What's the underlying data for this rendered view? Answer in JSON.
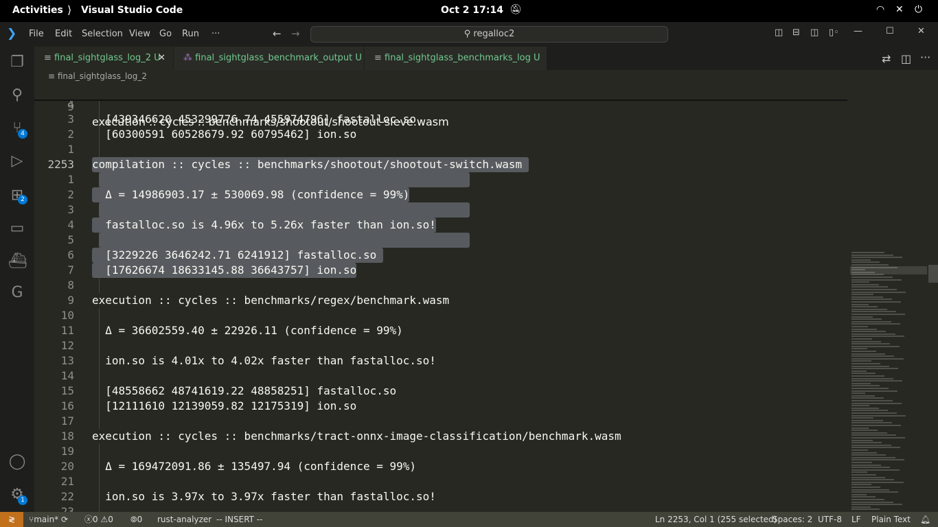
{
  "system_bar": {
    "activities": "Activities",
    "app": "Visual Studio Code",
    "clock": "Oct 2  17:14"
  },
  "menu": [
    "File",
    "Edit",
    "Selection",
    "View",
    "Go",
    "Run",
    "···"
  ],
  "search": {
    "value": "regalloc2"
  },
  "activity_badges": {
    "source_control": "4",
    "extensions": "2",
    "settings": "1"
  },
  "tabs": [
    {
      "label": "final_sightglass_log_2",
      "status": "U",
      "active": true
    },
    {
      "label": "final_sightglass_benchmark_output",
      "status": "U",
      "active": false
    },
    {
      "label": "final_sightglass_benchmarks_log",
      "status": "U",
      "active": false
    }
  ],
  "breadcrumb": "final_sightglass_log_2",
  "sticky": {
    "ln": "9",
    "text": "execution :: cycles :: benchmarks/shootout/shootout-sieve.wasm"
  },
  "lines": [
    {
      "ln": "4",
      "text": ""
    },
    {
      "ln": "3",
      "text": "  [439346620 453299776.74 455974796] fastalloc.so"
    },
    {
      "ln": "2",
      "text": "  [60300591 60528679.92 60795462] ion.so"
    },
    {
      "ln": "1",
      "text": ""
    },
    {
      "ln": "2253",
      "text": "compilation :: cycles :: benchmarks/shootout/shootout-switch.wasm ",
      "sel": true,
      "cur": true
    },
    {
      "ln": "1",
      "text": "",
      "sel": true
    },
    {
      "ln": "2",
      "text": "  Δ = 14986903.17 ± 530069.98 (confidence = 99%)",
      "sel": true
    },
    {
      "ln": "3",
      "text": "",
      "sel": true
    },
    {
      "ln": "4",
      "text": "  fastalloc.so is 4.96x to 5.26x faster than ion.so!",
      "sel": true
    },
    {
      "ln": "5",
      "text": "",
      "sel": true
    },
    {
      "ln": "6",
      "text": "  [3229226 3646242.71 6241912] fastalloc.so ",
      "sel": true
    },
    {
      "ln": "7",
      "text": "  [17626674 18633145.88 36643757] ion.so",
      "sel": true
    },
    {
      "ln": "8",
      "text": ""
    },
    {
      "ln": "9",
      "text": "execution :: cycles :: benchmarks/regex/benchmark.wasm"
    },
    {
      "ln": "10",
      "text": ""
    },
    {
      "ln": "11",
      "text": "  Δ = 36602559.40 ± 22926.11 (confidence = 99%)"
    },
    {
      "ln": "12",
      "text": ""
    },
    {
      "ln": "13",
      "text": "  ion.so is 4.01x to 4.02x faster than fastalloc.so!"
    },
    {
      "ln": "14",
      "text": ""
    },
    {
      "ln": "15",
      "text": "  [48558662 48741619.22 48858251] fastalloc.so"
    },
    {
      "ln": "16",
      "text": "  [12111610 12139059.82 12175319] ion.so"
    },
    {
      "ln": "17",
      "text": ""
    },
    {
      "ln": "18",
      "text": "execution :: cycles :: benchmarks/tract-onnx-image-classification/benchmark.wasm"
    },
    {
      "ln": "19",
      "text": ""
    },
    {
      "ln": "20",
      "text": "  Δ = 169472091.86 ± 135497.94 (confidence = 99%)"
    },
    {
      "ln": "21",
      "text": ""
    },
    {
      "ln": "22",
      "text": "  ion.so is 3.97x to 3.97x faster than fastalloc.so!"
    },
    {
      "ln": "23",
      "text": ""
    }
  ],
  "status": {
    "branch": "main*",
    "errors": "0",
    "warnings": "0",
    "ports": "0",
    "analyzer": "rust-analyzer",
    "mode": "-- INSERT --",
    "position": "Ln 2253, Col 1 (255 selected)",
    "spaces": "Spaces: 2",
    "encoding": "UTF-8",
    "eol": "LF",
    "language": "Plain Text"
  },
  "colors": {
    "editor_bg": "#272822",
    "selection": "#575b5f",
    "status_bar": "#414339",
    "remote": "#c1701c",
    "badge": "#0078d4",
    "modified_tab": "#73c991"
  }
}
